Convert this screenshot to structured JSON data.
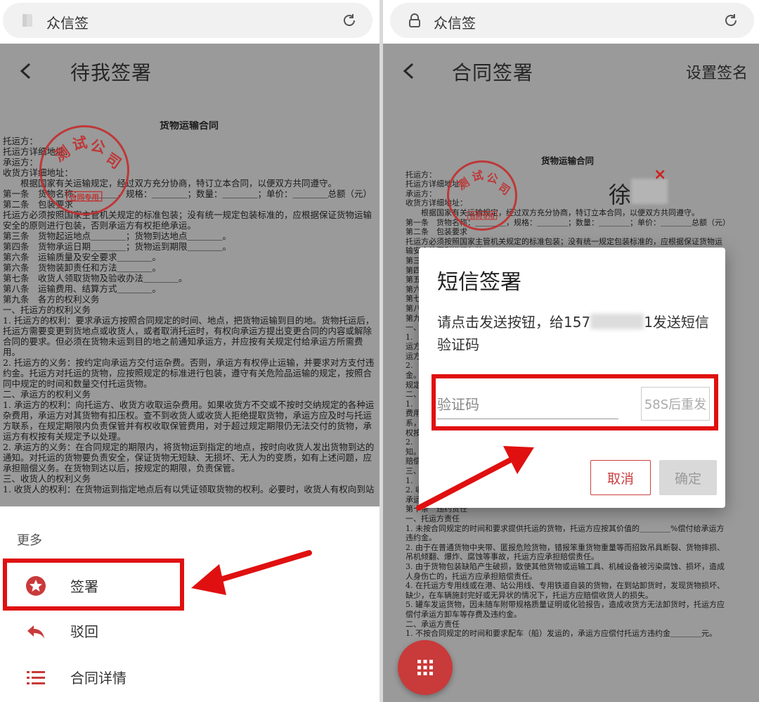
{
  "left": {
    "url_site": "众信签",
    "title": "待我签署",
    "document": {
      "title": "货物运输合同",
      "lines": [
        "托运方：",
        "托运方详细地址：",
        "承运方：",
        "收货方详细地址：",
        "　　根据国家有关运输规定，经过双方充分协商，特订立本合同，以便双方共同遵守。",
        "第一条　货物名称：＿＿＿＿，规格：＿＿＿＿；数量：＿＿＿＿；单价：＿＿＿＿总额（元）",
        "第二条　包装要求",
        "托运方必须按照国家主管机关规定的标准包装；没有统一规定包装标准的，应根据保证货物运输安全的原则进行包装，否则承运方有权拒绝承运。",
        "第三条　货物起运地点＿＿＿＿；货物到达地点＿＿＿＿。",
        "第四条　货物承运日期＿＿＿＿；货物运到期限＿＿＿＿。",
        "第六条　运输质量及安全要求＿＿＿＿。",
        "第六条　货物装卸责任和方法＿＿＿＿。",
        "第七条　收货人领取货物及验收办法＿＿＿＿。",
        "第八条　运输费用、结算方式＿＿＿＿。",
        "第九条　各方的权利义务",
        "一、托运方的权利义务",
        "1. 托运方的权利：要求承运方按照合同规定的时间、地点，把货物运输到目的地。货物托运后，托运方需要变更到货地点或收货人，或者取消托运时，有权向承运方提出变更合同的内容或解除合同的要求。但必须在货物未运到目的地之前通知承运方，并应按有关规定付给承运方所需费用。",
        "2. 托运方的义务：按约定向承运方交付运杂费。否则，承运方有权停止运输，并要求对方支付违约金。托运方对托运的货物，应按照规定的标准进行包装，遵守有关危险品运输的规定，按照合同中规定的时间和数量交付托运货物。",
        "二、承运方的权利义务",
        "1. 承运方的权利：向托运方、收货方收取运杂费用。如果收货方不交或不按时交纳规定的各种运杂费用，承运方对其货物有扣压权。查不到收货人或收货人拒绝提取货物，承运方应及时与托运方联系，在规定期限内负责保管并有权收取保管费用，对于超过规定期限仍无法交付的货物，承运方有权按有关规定予以处理。",
        "2. 承运方的义务：在合同规定的期限内，将货物运到指定的地点，按时向收货人发出货物到达的通知。对托运的货物要负责安全，保证货物无短缺、无损坏、无人为的变质，如有上述问题，应承担赔偿义务。在货物到达以后，按规定的期限，负责保管。",
        "三、收货人的权利义务",
        "1. 收货人的权利：在货物运到指定地点后有以凭证领取货物的权利。必要时，收货人有权向到站"
      ]
    },
    "sheet": {
      "more_label": "更多",
      "items": [
        {
          "label": "签署",
          "icon": "star-circle-icon"
        },
        {
          "label": "驳回",
          "icon": "reply-arrow-icon"
        },
        {
          "label": "合同详情",
          "icon": "list-icon"
        }
      ]
    }
  },
  "right": {
    "url_site": "众信签",
    "title": "合同签署",
    "action_label": "设置签名",
    "signature_text": "徐",
    "signature_remove": "×",
    "document": {
      "title": "货物运输合同",
      "lines": [
        "托运方：",
        "托运方详细地址：",
        "承运方：",
        "收货方详细地址：",
        "　　根据国家有关运输规定，经过双方充分协商，特订立本合同，以便双方共同遵守。",
        "第一条　货物名称：＿＿＿＿，规格：＿＿＿＿；数量：＿＿＿＿；单价：＿＿＿＿总额（元）",
        "第二条　包装要求",
        "托运方必须按照国家主管机关规定的标准包装；没有统一规定包装标准的，应根据保证货物运输安全的原则进行包装。",
        "第三条",
        "第四条",
        "第五条",
        "第六条",
        "第七条",
        "第八条",
        "第九条",
        "一、",
        "1.",
        "运方",
        "运方",
        "2.",
        "金。",
        "规定",
        "二、",
        "1.",
        "费用",
        "系，",
        "权按",
        "2.",
        "知。",
        "赔偿",
        "三、",
        "1.",
        "2. 收货人的义务：在接到提货通知后，按时提取货物，缴清应付费用。超过规定提货时，应向承运人交付保管费。",
        "第十条　违约责任",
        "一、托运方责任",
        "1. 未按合同规定的时间和要求提供托运的货物，托运方应按其价值的＿＿＿＿%偿付给承运方违约金。",
        "2. 由于在普通货物中夹带、匿报危险货物，错报笨重货物重量等而招致吊具断裂、货物摔损、吊机倾翻、爆炸、腐蚀等事故，托运方应承担赔偿责任。",
        "3. 由于货物包装缺陷产生破损，致使其他货物或运输工具、机械设备被污染腐蚀、损坏，造成人身伤亡的，托运方应承担赔偿责任。",
        "4. 在托运方专用线或在港、站公用线、专用铁道自装的货物，在到站卸货时，发现货物损坏、缺少，在车辆施封完好或无异状的情况下，托运方应赔偿收货人的损失。",
        "5. 罐车发运货物，因未随车附带规格质量证明或化验报告，造成收货方无法卸货时，托运方应偿付承运方卸车等存费及违约金。",
        "二、承运方责任",
        "1. 不按合同规定的时间和要求配车（船）发运的，承运方应偿付托运方违约金＿＿＿＿元。"
      ]
    },
    "dialog": {
      "title": "短信签署",
      "message_prefix": "请点击发送按钮，给157",
      "message_suffix": "1发送短信验证码",
      "code_placeholder": "验证码",
      "resend_label": "58S后重发",
      "cancel_label": "取消",
      "ok_label": "确定"
    }
  },
  "colors": {
    "accent": "#c93a3a",
    "highlight": "#e01010",
    "seal": "#c23030"
  }
}
